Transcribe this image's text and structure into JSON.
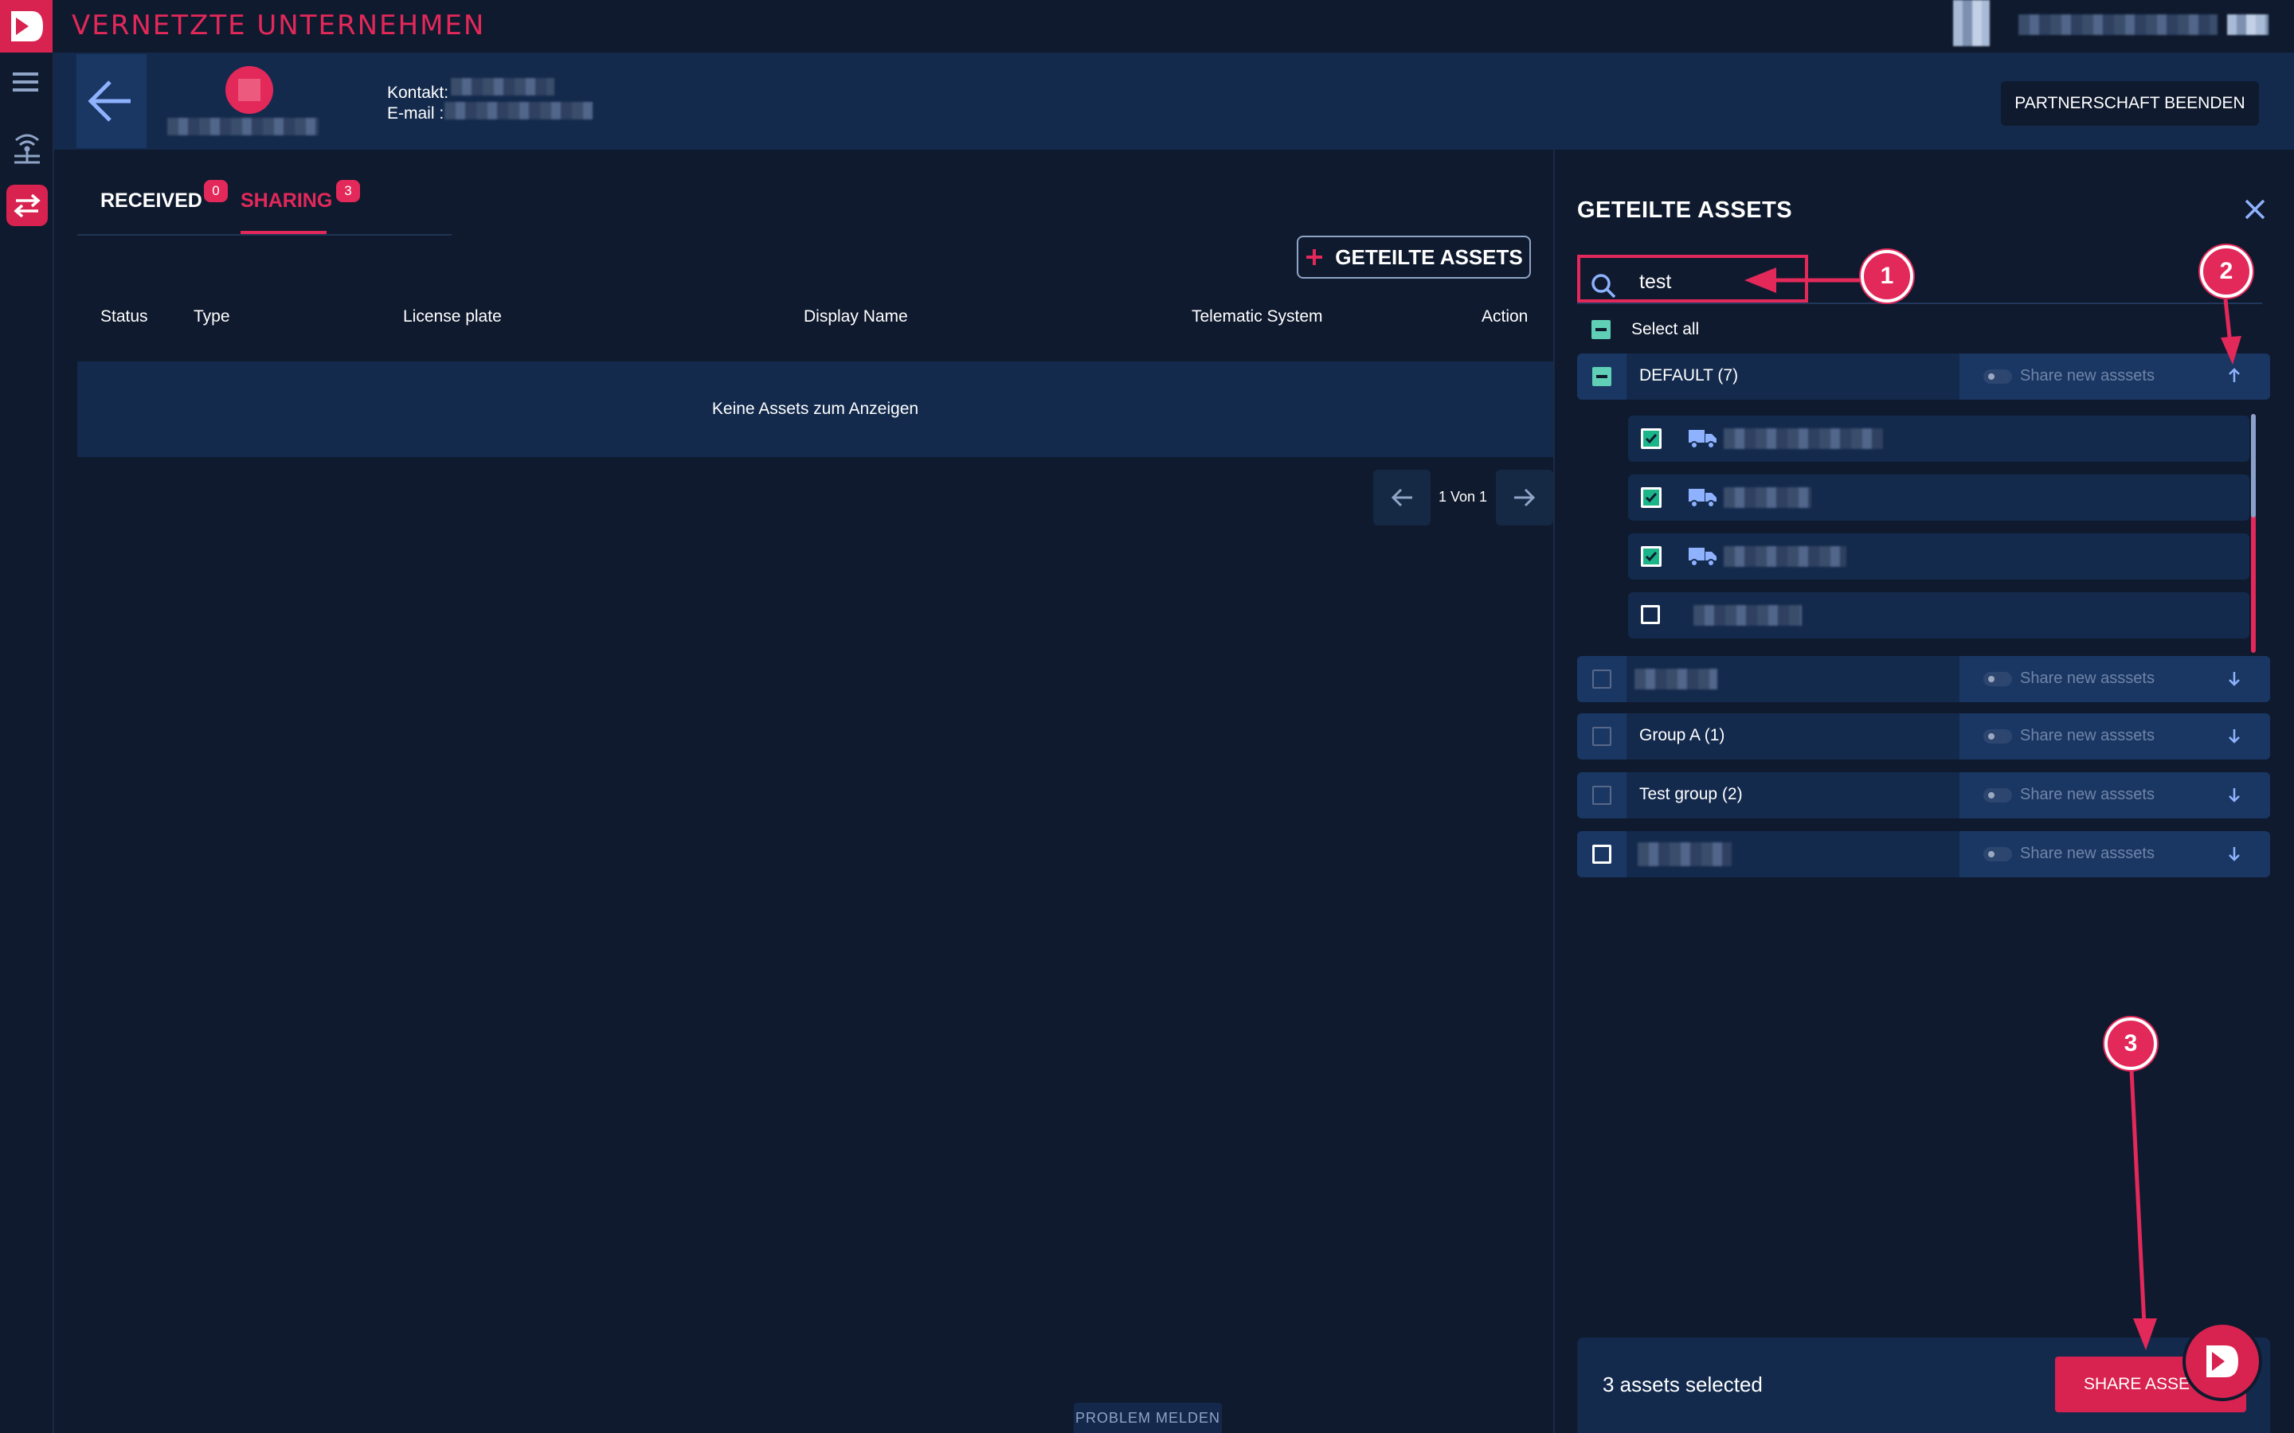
{
  "app": {
    "title": "VERNETZTE UNTERNEHMEN"
  },
  "partner": {
    "contact_label": "Kontakt:",
    "email_label": "E-mail :",
    "end_partnership_label": "PARTNERSCHAFT BEENDEN"
  },
  "tabs": [
    {
      "label": "RECEIVED",
      "count": "0",
      "active": false
    },
    {
      "label": "SHARING",
      "count": "3",
      "active": true
    }
  ],
  "table": {
    "add_button_label": "GETEILTE ASSETS",
    "columns": [
      "Status",
      "Type",
      "License plate",
      "Display Name",
      "Telematic System",
      "Action"
    ],
    "empty_message": "Keine Assets zum Anzeigen",
    "pagination": "1 Von 1"
  },
  "panel": {
    "title": "GETEILTE ASSETS",
    "search_value": "test",
    "select_all_label": "Select all",
    "groups": [
      {
        "label": "DEFAULT (7)",
        "share_label": "Share new asssets",
        "expanded": true
      },
      {
        "label": "",
        "share_label": "Share new asssets",
        "expanded": false
      },
      {
        "label": "Group A (1)",
        "share_label": "Share new asssets",
        "expanded": false
      },
      {
        "label": "Test group (2)",
        "share_label": "Share new asssets",
        "expanded": false
      },
      {
        "label": "",
        "share_label": "Share new asssets",
        "expanded": false
      }
    ],
    "assets": [
      {
        "checked": true,
        "icon": "truck-icon"
      },
      {
        "checked": true,
        "icon": "truck-icon"
      },
      {
        "checked": true,
        "icon": "truck-icon"
      },
      {
        "checked": false,
        "icon": ""
      }
    ],
    "footer": {
      "selected_text": "3 assets selected",
      "share_button_label": "SHARE ASSET("
    }
  },
  "problem_button_label": "PROBLEM MELDEN",
  "annotations": [
    "1",
    "2",
    "3"
  ],
  "colors": {
    "accent": "#e3285a",
    "background": "#0f1a2e",
    "header": "#132a4d",
    "check": "#1cb58a"
  }
}
